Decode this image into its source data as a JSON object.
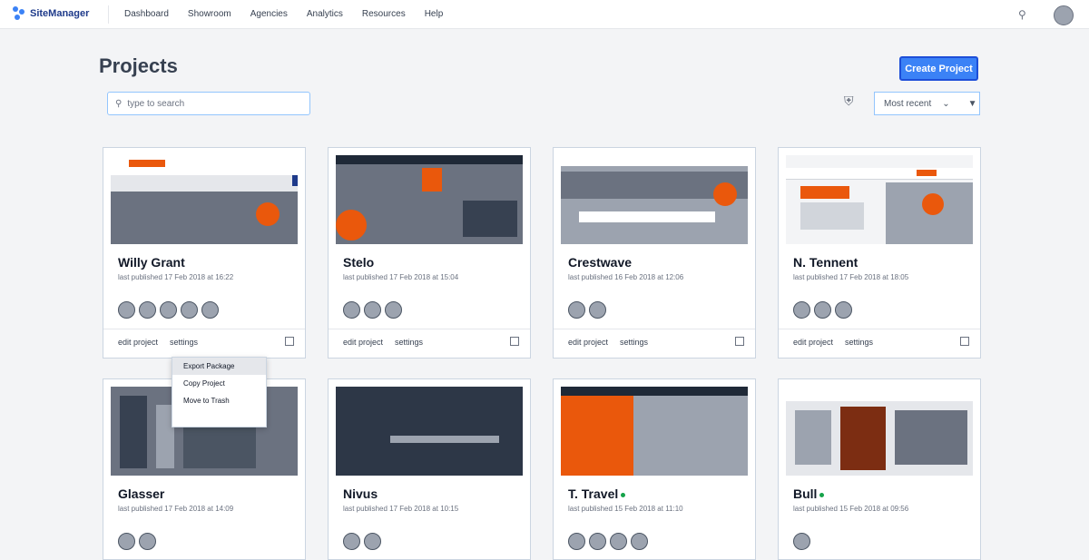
{
  "app": {
    "name": "SiteManager"
  },
  "nav": {
    "links": [
      "Dashboard",
      "Showroom",
      "Agencies",
      "Analytics",
      "Resources",
      "Help"
    ]
  },
  "page": {
    "title": "Projects",
    "create_label": "Create Project"
  },
  "search": {
    "placeholder": "type to search"
  },
  "sort": {
    "label": "Most recent"
  },
  "cards": [
    {
      "title": "Willy Grant",
      "sub": "last published 17 Feb 2018 at 16:22"
    },
    {
      "title": "Stelo",
      "sub": "last published 17 Feb 2018 at 15:04"
    },
    {
      "title": "Crestwave",
      "sub": "last published 16 Feb 2018 at 12:06"
    },
    {
      "title": "N. Tennent",
      "sub": "last published 17 Feb 2018 at 18:05"
    },
    {
      "title": "Glasser",
      "sub": "last published 17 Feb 2018 at 14:09"
    },
    {
      "title": "Nivus",
      "sub": "last published 17 Feb 2018 at 10:15"
    },
    {
      "title": "T. Travel",
      "sub": "last published 15 Feb 2018 at 11:10"
    },
    {
      "title": "Bull",
      "sub": "last published 15 Feb 2018 at 09:56"
    }
  ],
  "card_actions": {
    "edit": "edit project",
    "settings": "settings"
  },
  "menu": {
    "items": [
      "Export Package",
      "Copy Project",
      "Move to Trash"
    ]
  },
  "colors": {
    "accent": "#3b82f6",
    "brand": "#1e3a8a",
    "orange": "#ea580c"
  }
}
